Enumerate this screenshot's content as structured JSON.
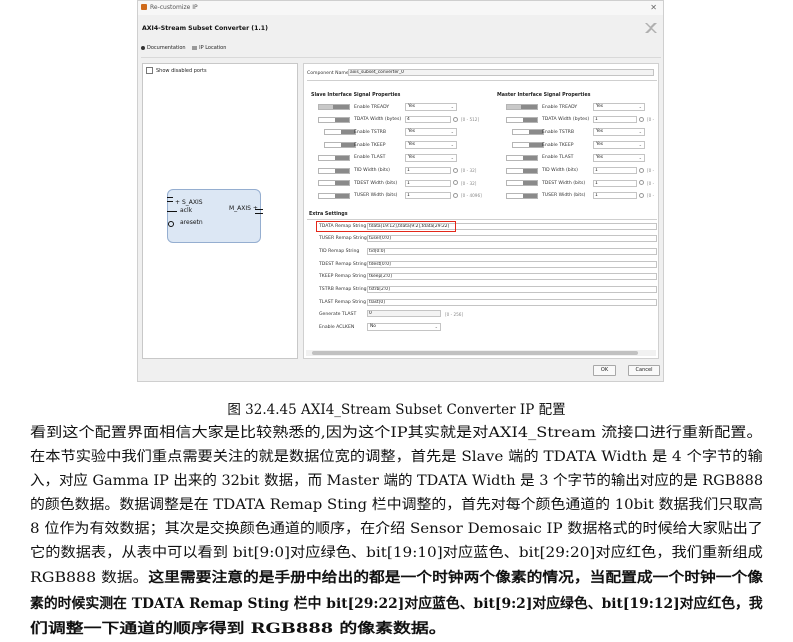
{
  "dialog": {
    "title": "Re-customize IP",
    "header": "AXI4-Stream Subset Converter (1.1)",
    "doc_link": "Documentation",
    "ip_location_link": "IP Location",
    "show_disabled_ports": "Show disabled ports",
    "block": {
      "ports_left": [
        "S_AXIS",
        "aclk",
        "aresetn"
      ],
      "port_right": "M_AXIS"
    },
    "component_name_label": "Component Name",
    "component_name_value": "axis_subset_converter_0",
    "slave_section": "Slave Interface Signal Properties",
    "master_section": "Master Interface Signal Properties",
    "slave_rows": [
      {
        "label": "Enable TREADY",
        "kind": "select",
        "value": "Yes",
        "toggle": "on",
        "range": ""
      },
      {
        "label": "TDATA Width (bytes)",
        "kind": "number",
        "value": "4",
        "toggle": "off",
        "range": "[0 - 512]"
      },
      {
        "label": "Enable TSTRB",
        "kind": "select",
        "value": "Yes",
        "toggle": "off",
        "range": ""
      },
      {
        "label": "Enable TKEEP",
        "kind": "select",
        "value": "Yes",
        "toggle": "off",
        "range": ""
      },
      {
        "label": "Enable TLAST",
        "kind": "select",
        "value": "Yes",
        "toggle": "off",
        "range": ""
      },
      {
        "label": "TID Width (bits)",
        "kind": "number",
        "value": "1",
        "toggle": "off",
        "range": "[0 - 32]"
      },
      {
        "label": "TDEST Width (bits)",
        "kind": "number",
        "value": "1",
        "toggle": "off",
        "range": "[0 - 32]"
      },
      {
        "label": "TUSER Width (bits)",
        "kind": "number",
        "value": "1",
        "toggle": "off",
        "range": "[0 - 4096]"
      }
    ],
    "master_rows": [
      {
        "label": "Enable TREADY",
        "kind": "select",
        "value": "Yes",
        "toggle": "on",
        "range": ""
      },
      {
        "label": "TDATA Width (bytes)",
        "kind": "number",
        "value": "1",
        "toggle": "off",
        "range": "[0 -"
      },
      {
        "label": "Enable TSTRB",
        "kind": "select",
        "value": "Yes",
        "toggle": "off",
        "range": ""
      },
      {
        "label": "Enable TKEEP",
        "kind": "select",
        "value": "Yes",
        "toggle": "off",
        "range": ""
      },
      {
        "label": "Enable TLAST",
        "kind": "select",
        "value": "Yes",
        "toggle": "off",
        "range": ""
      },
      {
        "label": "TID Width (bits)",
        "kind": "number",
        "value": "1",
        "toggle": "off",
        "range": "[0 -"
      },
      {
        "label": "TDEST Width (bits)",
        "kind": "number",
        "value": "1",
        "toggle": "off",
        "range": "[0 -"
      },
      {
        "label": "TUSER Width (bits)",
        "kind": "number",
        "value": "1",
        "toggle": "off",
        "range": "[0 -"
      }
    ],
    "extra_section": "Extra Settings",
    "extra_rows": [
      {
        "label": "TDATA Remap String",
        "value": "tdata[19:12],tdata[9:2],tdata[29:22]",
        "highlight": true
      },
      {
        "label": "TUSER Remap String",
        "value": "tuser[0:0]"
      },
      {
        "label": "TID Remap String",
        "value": "tid[0:0]"
      },
      {
        "label": "TDEST Remap String",
        "value": "tdest[0:0]"
      },
      {
        "label": "TKEEP Remap String",
        "value": "tkeep[2:0]"
      },
      {
        "label": "TSTRB Remap String",
        "value": "tstrb[2:0]"
      },
      {
        "label": "TLAST Remap String",
        "value": "tlast[0]"
      }
    ],
    "generate_tlast_label": "Generate TLAST",
    "generate_tlast_value": "0",
    "generate_tlast_range": "[0 - 256]",
    "enable_aclken_label": "Enable ACLKEN",
    "enable_aclken_value": "No",
    "ok_label": "OK",
    "cancel_label": "Cancel",
    "colors": {
      "highlight": "#e3281a",
      "block_fill": "#dce7f4"
    }
  },
  "caption": "图 32.4.45 AXI4_Stream Subset Converter IP 配置",
  "paragraph": [
    {
      "text": "看到这个配置界面相信大家是比较熟悉的,因为这个IP其实就是对AXI4_Stream 流接口进行重新配置。",
      "bold": false
    },
    {
      "text": "在本节实验中我们重点需要关注的就是数据位宽的调整，首先是 Slave 端的 TDATA Width 是 4 个字节的输",
      "bold": false
    },
    {
      "text": "入，对应 Gamma IP 出来的 32bit 数据，而 Master 端的 TDATA Width 是 3 个字节的输出对应的是 RGB888",
      "bold": false
    },
    {
      "text": "的颜色数据。数据调整是在 TDATA Remap Sting 栏中调整的，首先对每个颜色通道的 10bit 数据我们只取高",
      "bold": false
    },
    {
      "text": "8 位作为有效数据；其次是交换颜色通道的顺序，在介绍 Sensor Demosaic IP 数据格式的时候给大家贴出了",
      "bold": false
    },
    {
      "text": "它的数据表，从表中可以看到 bit[9:0]对应绿色、bit[19:10]对应蓝色、bit[29:20]对应红色，我们重新组成",
      "bold": false
    },
    {
      "text": "RGB888 数据。这里需要注意的是手册中给出的都是一个时钟两个像素的情况，当配置成一个时钟一个像",
      "bold": "partial",
      "plain": "RGB888 数据。",
      "boldtext": "这里需要注意的是手册中给出的都是一个时钟两个像素的情况，当配置成一个时钟一个像"
    },
    {
      "text": "素的时候实测在 TDATA Remap Sting 栏中 bit[29:22]对应蓝色、bit[9:2]对应绿色、bit[19:12]对应红色，我",
      "bold": true
    },
    {
      "text": "们调整一下通道的顺序得到 RGB888 的像素数据。",
      "bold": true
    }
  ]
}
